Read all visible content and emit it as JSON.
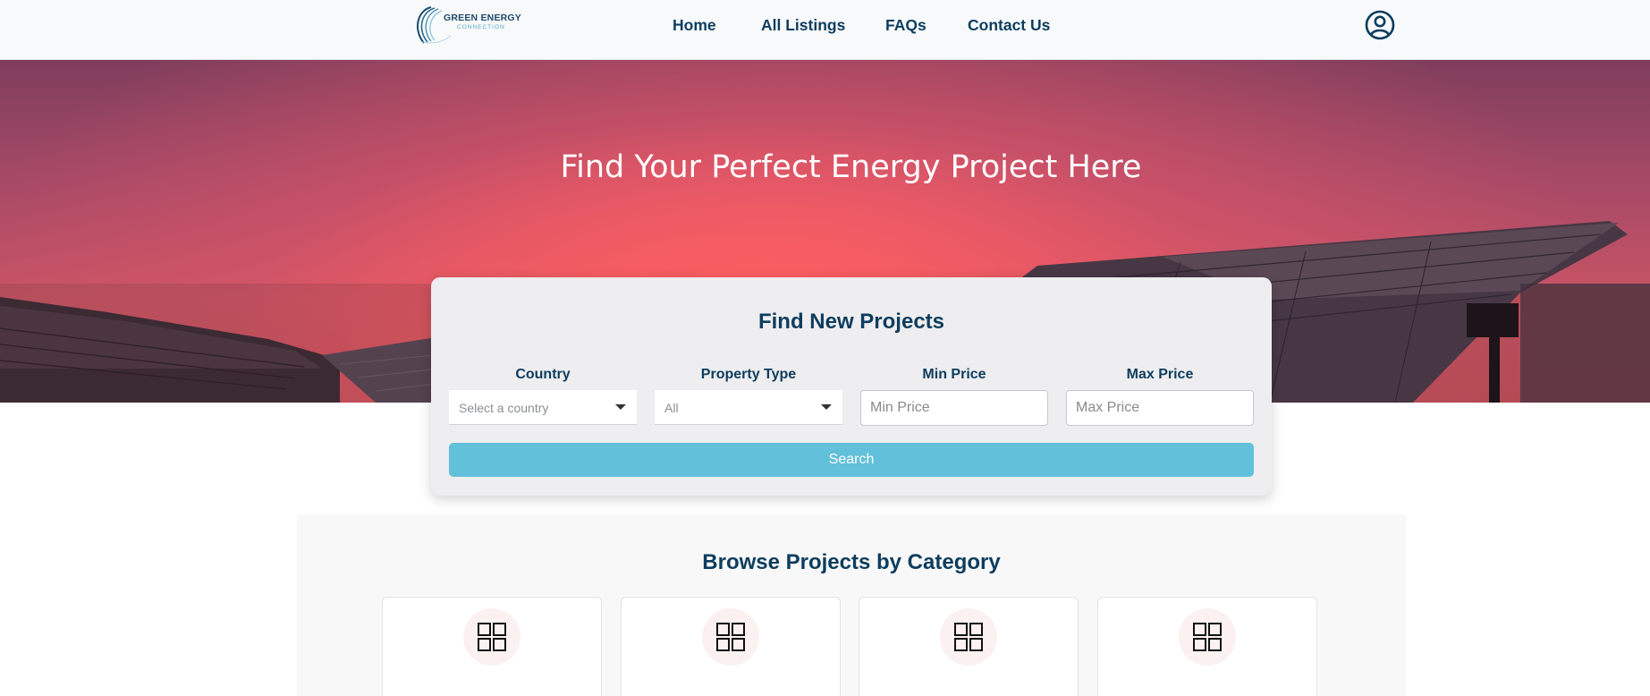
{
  "header": {
    "logo_title": "GREEN ENERGY",
    "logo_subtitle": "CONNECTION",
    "nav": [
      {
        "label": "Home"
      },
      {
        "label": "All Listings"
      },
      {
        "label": "FAQs"
      },
      {
        "label": "Contact Us"
      }
    ],
    "account_icon": "user-circle-icon"
  },
  "hero": {
    "title": "Find Your Perfect Energy Project Here"
  },
  "search": {
    "title": "Find New Projects",
    "country": {
      "label": "Country",
      "value": "Select a country"
    },
    "property_type": {
      "label": "Property Type",
      "value": "All"
    },
    "min_price": {
      "label": "Min Price",
      "placeholder": "Min Price"
    },
    "max_price": {
      "label": "Max Price",
      "placeholder": "Max Price"
    },
    "button_label": "Search"
  },
  "browse": {
    "title": "Browse Projects by Category",
    "category_icon": "grid-icon"
  },
  "colors": {
    "primary": "#0d3d5e",
    "accent": "#62c0da",
    "header_bg": "#f7f9fa"
  }
}
